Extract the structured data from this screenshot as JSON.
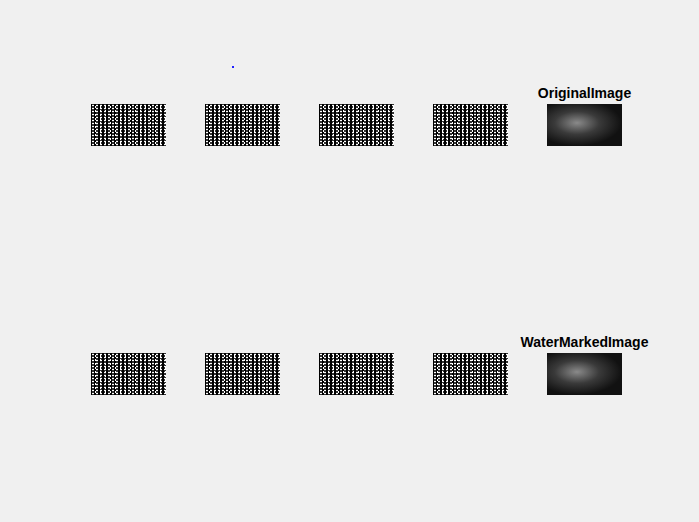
{
  "figure": {
    "rows": [
      {
        "title": "OriginalImage",
        "images": [
          {
            "kind": "bitplane"
          },
          {
            "kind": "bitplane"
          },
          {
            "kind": "bitplane"
          },
          {
            "kind": "bitplane"
          },
          {
            "kind": "photo"
          }
        ]
      },
      {
        "title": "WaterMarkedImage",
        "images": [
          {
            "kind": "bitplane"
          },
          {
            "kind": "bitplane"
          },
          {
            "kind": "bitplane"
          },
          {
            "kind": "bitplane"
          },
          {
            "kind": "photo"
          }
        ]
      }
    ]
  }
}
